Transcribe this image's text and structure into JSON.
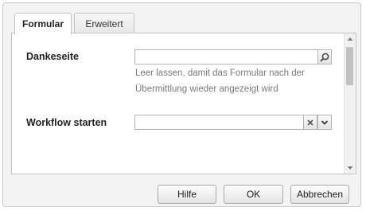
{
  "tabs": [
    {
      "label": "Formular",
      "active": true
    },
    {
      "label": "Erweitert",
      "active": false
    }
  ],
  "form": {
    "thank_you_page": {
      "label": "Dankeseite",
      "value": "",
      "help": "Leer lassen, damit das Formular nach der Übermittlung wieder angezeigt wird",
      "trigger_icon": "search-icon"
    },
    "start_workflow": {
      "label": "Workflow starten",
      "value": "",
      "clear_icon": "close-icon",
      "dropdown_icon": "chevron-down-icon"
    }
  },
  "buttons": {
    "help": "Hilfe",
    "ok": "OK",
    "cancel": "Abbrechen"
  },
  "colors": {
    "dialog_bg": "#f3f3f3",
    "panel_bg": "#ffffff",
    "border": "#c2c2c2",
    "help_text": "#7a7a7a"
  }
}
